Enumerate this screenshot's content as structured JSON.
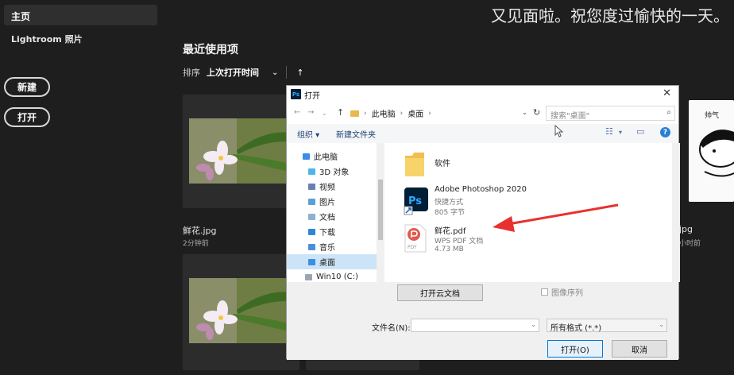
{
  "sidebar": {
    "home_label": "主页",
    "lightroom_label": "Lightroom 照片",
    "new_button": "新建",
    "open_button": "打开"
  },
  "welcome_text": "又见面啦。祝您度过愉快的一天。",
  "recent": {
    "title": "最近使用项",
    "sort_label": "排序",
    "sort_value": "上次打开时间",
    "files": [
      {
        "name": "鲜花.jpg",
        "time": "2分钟前"
      }
    ],
    "right_card_name": "jpg",
    "right_card_time": "小时前"
  },
  "dialog": {
    "title": "打开",
    "breadcrumb": [
      "此电脑",
      "桌面"
    ],
    "search_placeholder": "搜索\"桌面\"",
    "organize": "组织 ▾",
    "new_folder": "新建文件夹",
    "nav_items": [
      {
        "label": "此电脑",
        "icon": "computer-icon"
      },
      {
        "label": "3D 对象",
        "icon": "3d-objects-icon"
      },
      {
        "label": "视频",
        "icon": "video-icon"
      },
      {
        "label": "图片",
        "icon": "pictures-icon"
      },
      {
        "label": "文档",
        "icon": "documents-icon"
      },
      {
        "label": "下载",
        "icon": "downloads-icon"
      },
      {
        "label": "音乐",
        "icon": "music-icon"
      },
      {
        "label": "桌面",
        "icon": "desktop-icon"
      },
      {
        "label": "Win10 (C:)",
        "icon": "drive-icon"
      }
    ],
    "files": [
      {
        "name": "软件",
        "icon": "folder-icon"
      },
      {
        "name": "Adobe Photoshop 2020",
        "type": "快捷方式",
        "size": "805 字节",
        "icon": "photoshop-icon"
      },
      {
        "name": "鲜花.pdf",
        "type": "WPS PDF 文档",
        "size": "4.73 MB",
        "icon": "pdf-icon"
      }
    ],
    "cloud_button": "打开云文档",
    "image_sequence": "图像序列",
    "filename_label": "文件名(N):",
    "filename_value": "",
    "format_value": "所有格式 (*.*)",
    "open_button": "打开(O)",
    "cancel_button": "取消"
  },
  "colors": {
    "background": "#1e1e1e",
    "dialog": "#f0f0f0",
    "selection": "#cce4f7",
    "arrow": "#e8312f",
    "photoshop_blue": "#31a8ff"
  }
}
